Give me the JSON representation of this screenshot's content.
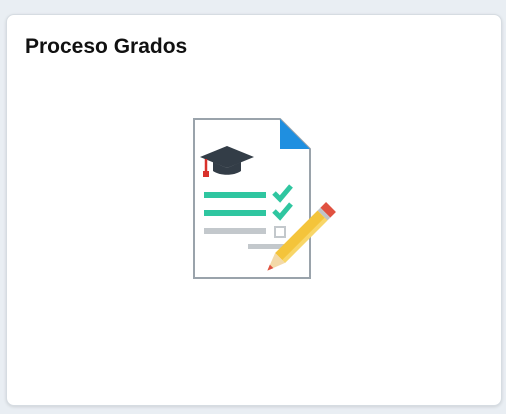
{
  "tile": {
    "title": "Proceso Grados",
    "icon": "document-checklist-pencil-icon"
  },
  "colors": {
    "background": "#e9eef3",
    "tile_background": "#ffffff",
    "title_text": "#111111",
    "graduation_cap": "#333d47",
    "tassel": "#d9312b",
    "check_green": "#2fc6a0",
    "gray_line": "#c3c8cc",
    "page_fold_blue": "#1f8fe0",
    "pencil_yellow": "#f4c43a",
    "pencil_eraser": "#e05140"
  }
}
